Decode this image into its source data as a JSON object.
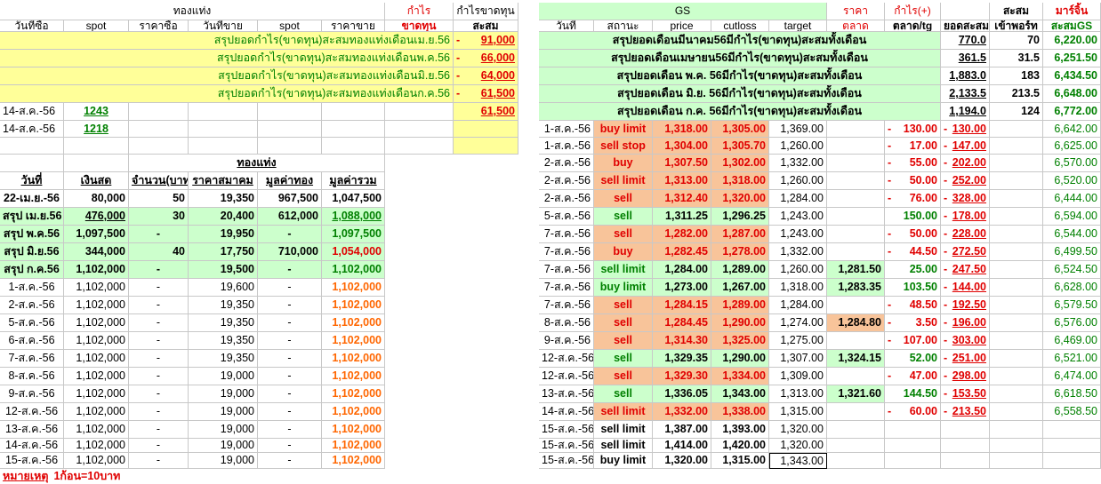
{
  "left": {
    "header": {
      "group_gold": "ทองแท่ง",
      "profit": "กำไร",
      "loss": "ขาดทุน",
      "profit_loss": "กำไรขาดทุน",
      "cumulative": "สะสม",
      "col_buy_date": "วันที่ซื้อ",
      "col_spot": "spot",
      "col_buy_price": "ราคาซื้อ",
      "col_sell_date": "วันที่ขาย",
      "col_spot2": "spot",
      "col_sell_price": "ราคาขาย"
    },
    "summaries": [
      {
        "label": "สรุปยอดกำไร(ขาดทุน)สะสมทองแท่งเดือนเม.ย.56",
        "value": "91,000"
      },
      {
        "label": "สรุปยอดกำไร(ขาดทุน)สะสมทองแท่งเดือนพ.ค.56",
        "value": "66,000"
      },
      {
        "label": "สรุปยอดกำไร(ขาดทุน)สะสมทองแท่งเดือนมิ.ย.56",
        "value": "64,000"
      },
      {
        "label": "สรุปยอดกำไร(ขาดทุน)สะสมทองแท่งเดือนก.ค.56",
        "value": "61,500"
      }
    ],
    "trades": [
      {
        "date": "14-ส.ค.-56",
        "spot": "1243",
        "value": "61,500"
      },
      {
        "date": "14-ส.ค.-56",
        "spot": "1218",
        "value": ""
      }
    ],
    "table": {
      "group_label": "ทองแท่ง",
      "col_date": "วันที่",
      "col_cash": "เงินสด",
      "col_qty": "จำนวน(บาท",
      "col_assoc_price": "ราคาสมาคม",
      "col_gold_value": "มูลค่าทอง",
      "col_total_value": "มูลค่ารวม",
      "rows": [
        {
          "date": "22-เม.ย.-56",
          "cash": "80,000",
          "qty": "50",
          "price": "19,350",
          "gold": "967,500",
          "total": "1,047,500"
        },
        {
          "date": "สรุป เม.ย.56",
          "cash": "476,000",
          "qty": "30",
          "price": "20,400",
          "gold": "612,000",
          "total": "1,088,000"
        },
        {
          "date": "สรุป พ.ค.56",
          "cash": "1,097,500",
          "qty": "-",
          "price": "19,950",
          "gold": "-",
          "total": "1,097,500"
        },
        {
          "date": "สรุป มิ.ย.56",
          "cash": "344,000",
          "qty": "40",
          "price": "17,750",
          "gold": "710,000",
          "total": "1,054,000"
        },
        {
          "date": "สรุป ก.ค.56",
          "cash": "1,102,000",
          "qty": "-",
          "price": "19,500",
          "gold": "-",
          "total": "1,102,000"
        },
        {
          "date": "1-ส.ค.-56",
          "cash": "1,102,000",
          "qty": "-",
          "price": "19,600",
          "gold": "-",
          "total": "1,102,000"
        },
        {
          "date": "2-ส.ค.-56",
          "cash": "1,102,000",
          "qty": "-",
          "price": "19,350",
          "gold": "-",
          "total": "1,102,000"
        },
        {
          "date": "5-ส.ค.-56",
          "cash": "1,102,000",
          "qty": "-",
          "price": "19,350",
          "gold": "-",
          "total": "1,102,000"
        },
        {
          "date": "6-ส.ค.-56",
          "cash": "1,102,000",
          "qty": "-",
          "price": "19,350",
          "gold": "-",
          "total": "1,102,000"
        },
        {
          "date": "7-ส.ค.-56",
          "cash": "1,102,000",
          "qty": "-",
          "price": "19,350",
          "gold": "-",
          "total": "1,102,000"
        },
        {
          "date": "8-ส.ค.-56",
          "cash": "1,102,000",
          "qty": "-",
          "price": "19,000",
          "gold": "-",
          "total": "1,102,000"
        },
        {
          "date": "9-ส.ค.-56",
          "cash": "1,102,000",
          "qty": "-",
          "price": "19,000",
          "gold": "-",
          "total": "1,102,000"
        },
        {
          "date": "12-ส.ค.-56",
          "cash": "1,102,000",
          "qty": "-",
          "price": "19,000",
          "gold": "-",
          "total": "1,102,000"
        },
        {
          "date": "13-ส.ค.-56",
          "cash": "1,102,000",
          "qty": "-",
          "price": "19,000",
          "gold": "-",
          "total": "1,102,000"
        },
        {
          "date": "14-ส.ค.-56",
          "cash": "1,102,000",
          "qty": "-",
          "price": "19,000",
          "gold": "-",
          "total": "1,102,000"
        },
        {
          "date": "15-ส.ค.-56",
          "cash": "1,102,000",
          "qty": "-",
          "price": "19,000",
          "gold": "-",
          "total": "1,102,000"
        }
      ]
    },
    "note_label": "หมายเหตุ",
    "note_text": "1ก้อน=10บาท"
  },
  "right": {
    "header": {
      "gs": "GS",
      "price_label": "ราคา",
      "profit_plus": "กำไร(+)",
      "cumulative": "สะสม",
      "margin": "มาร์จิ้น",
      "col_date": "วันที่",
      "col_status": "สถานะ",
      "col_price": "price",
      "col_cutloss": "cutloss",
      "col_target": "target",
      "col_market": "ตลาด",
      "col_market_tg": "ตลาด/tg",
      "col_total": "ยอดสะสม",
      "col_port": "เข้าพอร์ท",
      "col_gs_total": "สะสมGS"
    },
    "summaries": [
      {
        "label": "สรุปยอดเดือนมีนาคม56มีกำไร(ขาดทุน)สะสมทั้งเดือน",
        "total": "770.0",
        "port": "70",
        "gs": "6,220.00"
      },
      {
        "label": "สรุปยอดเดือนเมษายน56มีกำไร(ขาดทุน)สะสมทั้งเดือน",
        "total": "361.5",
        "port": "31.5",
        "gs": "6,251.50"
      },
      {
        "label": "สรุปยอดเดือน พ.ค. 56มีกำไร(ขาดทุน)สะสมทั้งเดือน",
        "total": "1,883.0",
        "port": "183",
        "gs": "6,434.50"
      },
      {
        "label": "สรุปยอดเดือน มิ.ย. 56มีกำไร(ขาดทุน)สะสมทั้งเดือน",
        "total": "2,133.5",
        "port": "213.5",
        "gs": "6,648.00"
      },
      {
        "label": "สรุปยอดเดือน ก.ค. 56มีกำไร(ขาดทุน)สะสมทั้งเดือน",
        "total": "1,194.0",
        "port": "124",
        "gs": "6,772.00"
      }
    ],
    "trades": [
      {
        "date": "1-ส.ค.-56",
        "status": "buy limit",
        "price": "1,318.00",
        "cutloss": "1,305.00",
        "target": "1,369.00",
        "market": "",
        "pl": "130.00",
        "neg": true,
        "total": "130.00",
        "gs": "6,642.00"
      },
      {
        "date": "1-ส.ค.-56",
        "status": "sell stop",
        "price": "1,304.00",
        "cutloss": "1,305.70",
        "target": "1,260.00",
        "market": "",
        "pl": "17.00",
        "neg": true,
        "total": "147.00",
        "gs": "6,625.00"
      },
      {
        "date": "2-ส.ค.-56",
        "status": "buy",
        "price": "1,307.50",
        "cutloss": "1,302.00",
        "target": "1,332.00",
        "market": "",
        "pl": "55.00",
        "neg": true,
        "total": "202.00",
        "gs": "6,570.00"
      },
      {
        "date": "2-ส.ค.-56",
        "status": "sell limit",
        "price": "1,313.00",
        "cutloss": "1,318.00",
        "target": "1,260.00",
        "market": "",
        "pl": "50.00",
        "neg": true,
        "total": "252.00",
        "gs": "6,520.00"
      },
      {
        "date": "2-ส.ค.-56",
        "status": "sell",
        "price": "1,312.40",
        "cutloss": "1,320.00",
        "target": "1,284.00",
        "market": "",
        "pl": "76.00",
        "neg": true,
        "total": "328.00",
        "gs": "6,444.00"
      },
      {
        "date": "5-ส.ค.-56",
        "status": "sell",
        "price": "1,311.25",
        "cutloss": "1,296.25",
        "target": "1,243.00",
        "market": "",
        "pl": "150.00",
        "neg": false,
        "total": "178.00",
        "gs": "6,594.00"
      },
      {
        "date": "7-ส.ค.-56",
        "status": "sell",
        "price": "1,282.00",
        "cutloss": "1,287.00",
        "target": "1,243.00",
        "market": "",
        "pl": "50.00",
        "neg": true,
        "total": "228.00",
        "gs": "6,544.00"
      },
      {
        "date": "7-ส.ค.-56",
        "status": "buy",
        "price": "1,282.45",
        "cutloss": "1,278.00",
        "target": "1,332.00",
        "market": "",
        "pl": "44.50",
        "neg": true,
        "total": "272.50",
        "gs": "6,499.50"
      },
      {
        "date": "7-ส.ค.-56",
        "status": "sell limit",
        "price": "1,284.00",
        "cutloss": "1,289.00",
        "target": "1,260.00",
        "market": "1,281.50",
        "pl": "25.00",
        "neg": false,
        "total": "247.50",
        "gs": "6,524.50"
      },
      {
        "date": "7-ส.ค.-56",
        "status": "buy limit",
        "price": "1,273.00",
        "cutloss": "1,267.00",
        "target": "1,318.00",
        "market": "1,283.35",
        "pl": "103.50",
        "neg": false,
        "total": "144.00",
        "gs": "6,628.00"
      },
      {
        "date": "7-ส.ค.-56",
        "status": "sell",
        "price": "1,284.15",
        "cutloss": "1,289.00",
        "target": "1,284.00",
        "market": "",
        "pl": "48.50",
        "neg": true,
        "total": "192.50",
        "gs": "6,579.50"
      },
      {
        "date": "8-ส.ค.-56",
        "status": "sell",
        "price": "1,284.45",
        "cutloss": "1,290.00",
        "target": "1,274.00",
        "market": "1,284.80",
        "pl": "3.50",
        "neg": true,
        "total": "196.00",
        "gs": "6,576.00"
      },
      {
        "date": "9-ส.ค.-56",
        "status": "sell",
        "price": "1,314.30",
        "cutloss": "1,325.00",
        "target": "1,275.00",
        "market": "",
        "pl": "107.00",
        "neg": true,
        "total": "303.00",
        "gs": "6,469.00"
      },
      {
        "date": "12-ส.ค.-56",
        "status": "sell",
        "price": "1,329.35",
        "cutloss": "1,290.00",
        "target": "1,307.00",
        "market": "1,324.15",
        "pl": "52.00",
        "neg": false,
        "total": "251.00",
        "gs": "6,521.00"
      },
      {
        "date": "12-ส.ค.-56",
        "status": "sell",
        "price": "1,329.30",
        "cutloss": "1,334.00",
        "target": "1,309.00",
        "market": "",
        "pl": "47.00",
        "neg": true,
        "total": "298.00",
        "gs": "6,474.00"
      },
      {
        "date": "13-ส.ค.-56",
        "status": "sell",
        "price": "1,336.05",
        "cutloss": "1,343.00",
        "target": "1,313.00",
        "market": "1,321.60",
        "pl": "144.50",
        "neg": false,
        "total": "153.50",
        "gs": "6,618.50"
      },
      {
        "date": "14-ส.ค.-56",
        "status": "sell limit",
        "price": "1,332.00",
        "cutloss": "1,338.00",
        "target": "1,315.00",
        "market": "",
        "pl": "60.00",
        "neg": true,
        "total": "213.50",
        "gs": "6,558.50"
      },
      {
        "date": "15-ส.ค.-56",
        "status": "sell limit",
        "price": "1,387.00",
        "cutloss": "1,393.00",
        "target": "1,320.00",
        "market": "",
        "pl": "",
        "neg": false,
        "total": "",
        "gs": ""
      },
      {
        "date": "15-ส.ค.-56",
        "status": "sell limit",
        "price": "1,414.00",
        "cutloss": "1,420.00",
        "target": "1,320.00",
        "market": "",
        "pl": "",
        "neg": false,
        "total": "",
        "gs": ""
      },
      {
        "date": "15-ส.ค.-56",
        "status": "buy limit",
        "price": "1,320.00",
        "cutloss": "1,315.00",
        "target": "1,343.00",
        "market": "",
        "pl": "",
        "neg": false,
        "total": "",
        "gs": ""
      }
    ]
  },
  "colors": {
    "yellow": "#ffff99",
    "green_fill": "#ccffcc",
    "orange_fill": "#f8c49a",
    "red_text": "#e00000",
    "green_text": "#008000",
    "orange_text": "#ff6600"
  }
}
